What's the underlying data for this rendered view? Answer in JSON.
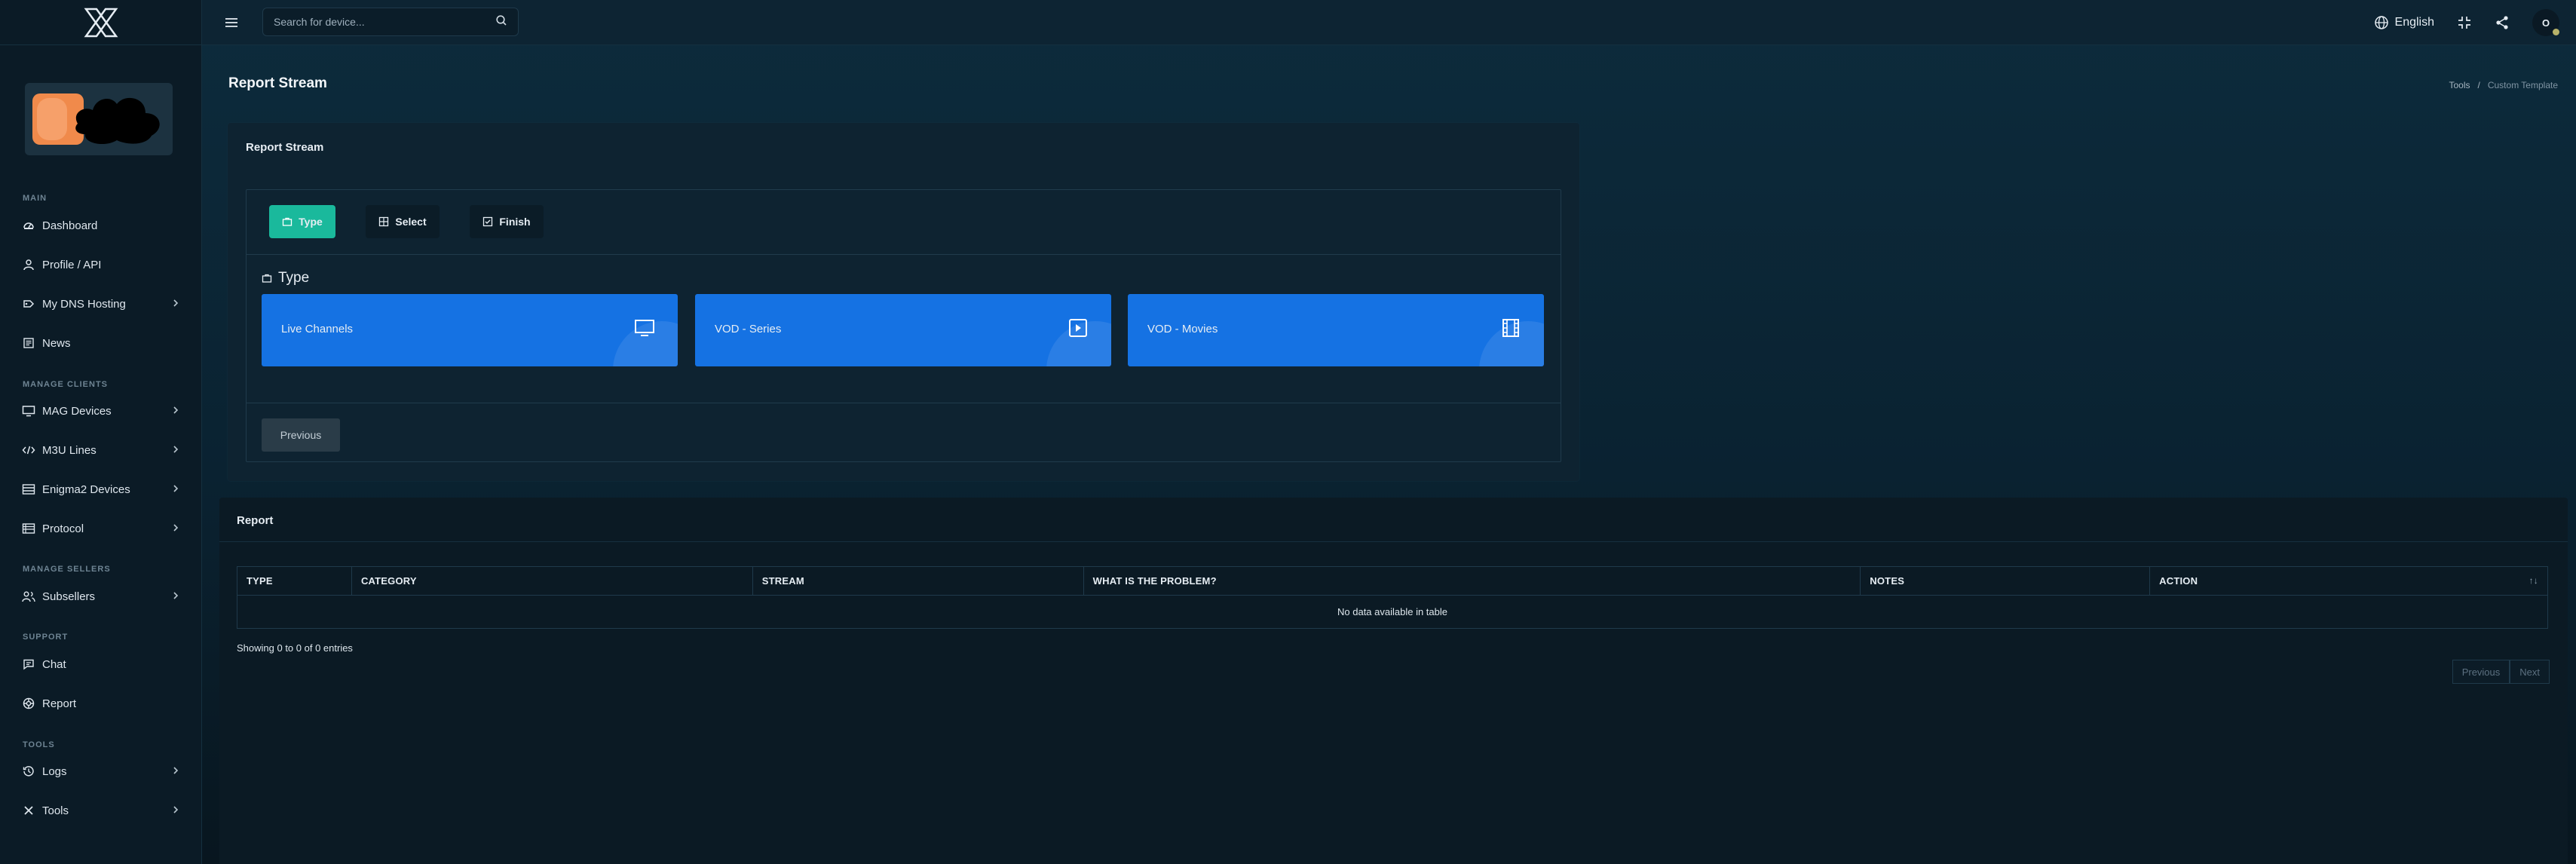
{
  "sidebar": {
    "sections": {
      "main": "MAIN",
      "manage_clients": "MANAGE CLIENTS",
      "manage_sellers": "MANAGE SELLERS",
      "support": "SUPPORT",
      "tools": "TOOLS"
    },
    "items": [
      {
        "label": "Dashboard",
        "icon": "dashboard-icon",
        "chevron": false
      },
      {
        "label": "Profile / API",
        "icon": "user-icon",
        "chevron": false
      },
      {
        "label": "My DNS Hosting",
        "icon": "dns-icon",
        "chevron": true
      },
      {
        "label": "News",
        "icon": "news-icon",
        "chevron": false
      },
      {
        "label": "MAG Devices",
        "icon": "monitor-icon",
        "chevron": true
      },
      {
        "label": "M3U Lines",
        "icon": "code-icon",
        "chevron": true
      },
      {
        "label": "Enigma2 Devices",
        "icon": "server-icon",
        "chevron": true
      },
      {
        "label": "Protocol",
        "icon": "protocol-icon",
        "chevron": true
      },
      {
        "label": "Subsellers",
        "icon": "users-icon",
        "chevron": true
      },
      {
        "label": "Chat",
        "icon": "chat-icon",
        "chevron": false
      },
      {
        "label": "Report",
        "icon": "lifebuoy-icon",
        "chevron": false
      },
      {
        "label": "Logs",
        "icon": "history-icon",
        "chevron": true
      },
      {
        "label": "Tools",
        "icon": "tools-icon",
        "chevron": true
      }
    ]
  },
  "topbar": {
    "search_placeholder": "Search for device...",
    "language": "English",
    "user_initial": "O"
  },
  "page": {
    "title": "Report Stream",
    "breadcrumb": [
      "Tools",
      "/",
      "Custom Template"
    ]
  },
  "report_stream": {
    "card_title": "Report Stream",
    "steps": [
      "Type",
      "Select",
      "Finish"
    ],
    "active_step": "Type",
    "section_heading": "Type",
    "tiles": [
      {
        "label": "Live Channels",
        "icon": "tv-icon"
      },
      {
        "label": "VOD - Series",
        "icon": "play-square-icon"
      },
      {
        "label": "VOD - Movies",
        "icon": "film-icon"
      }
    ],
    "previous_label": "Previous"
  },
  "report": {
    "card_title": "Report",
    "columns": [
      "TYPE",
      "CATEGORY",
      "STREAM",
      "WHAT IS THE PROBLEM?",
      "NOTES",
      "ACTION"
    ],
    "empty_text": "No data available in table",
    "showing_text": "Showing 0 to 0 of 0 entries",
    "pager": {
      "previous": "Previous",
      "next": "Next"
    }
  },
  "colors": {
    "accent_teal": "#1ab99c",
    "tile_blue": "#1572e3",
    "background": "#0d2b3c"
  }
}
